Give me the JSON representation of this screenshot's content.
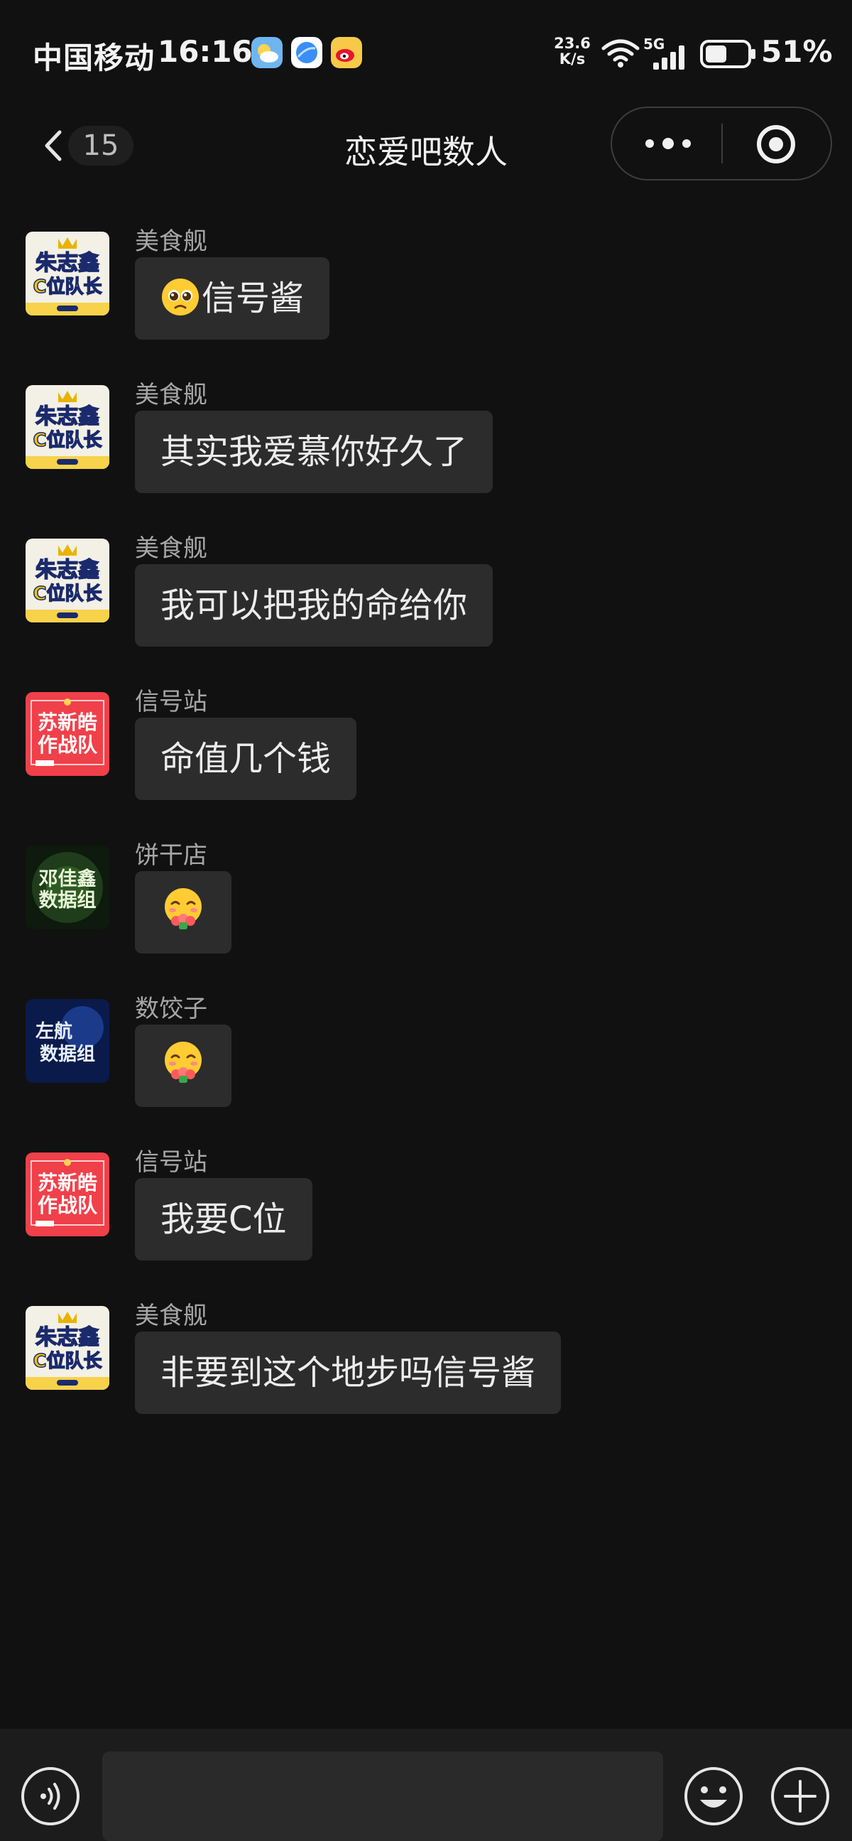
{
  "status_bar": {
    "carrier": "中国移动",
    "time": "16:16",
    "net_speed_value": "23.6",
    "net_speed_unit": "K/s",
    "network_type": "5G",
    "battery": "51%",
    "battery_level": 0.51,
    "app_icons": [
      "weather-icon",
      "browser-icon",
      "weibo-icon"
    ]
  },
  "nav": {
    "back_count": "15",
    "title": "恋爱吧数人"
  },
  "avatar_texts": {
    "meishijian": [
      "朱志鑫",
      "C位队长"
    ],
    "xinhaozhan": [
      "苏新皓",
      "作战队"
    ],
    "binggandian": [
      "邓佳鑫",
      "数据组"
    ],
    "shujiaozi": [
      "左航",
      "数据组"
    ]
  },
  "messages": [
    {
      "sender": "美食舰",
      "avatar": "meishijian",
      "emoji": "pleading-face-icon",
      "text": "信号酱"
    },
    {
      "sender": "美食舰",
      "avatar": "meishijian",
      "emoji": "",
      "text": "其实我爱慕你好久了"
    },
    {
      "sender": "美食舰",
      "avatar": "meishijian",
      "emoji": "",
      "text": "我可以把我的命给你"
    },
    {
      "sender": "信号站",
      "avatar": "xinhaozhan",
      "emoji": "",
      "text": "命值几个钱"
    },
    {
      "sender": "饼干店",
      "avatar": "binggandian",
      "emoji": "shy-flower-face-icon",
      "text": ""
    },
    {
      "sender": "数饺子",
      "avatar": "shujiaozi",
      "emoji": "shy-flower-face-icon",
      "text": ""
    },
    {
      "sender": "信号站",
      "avatar": "xinhaozhan",
      "emoji": "",
      "text": "我要C位"
    },
    {
      "sender": "美食舰",
      "avatar": "meishijian",
      "emoji": "",
      "text": "非要到这个地步吗信号酱"
    }
  ],
  "colors": {
    "background": "#111111",
    "bubble": "#2c2c2c",
    "sender_text": "#a6a6a6",
    "bubble_text": "#ececec",
    "input_bar": "#1c1c1c"
  }
}
